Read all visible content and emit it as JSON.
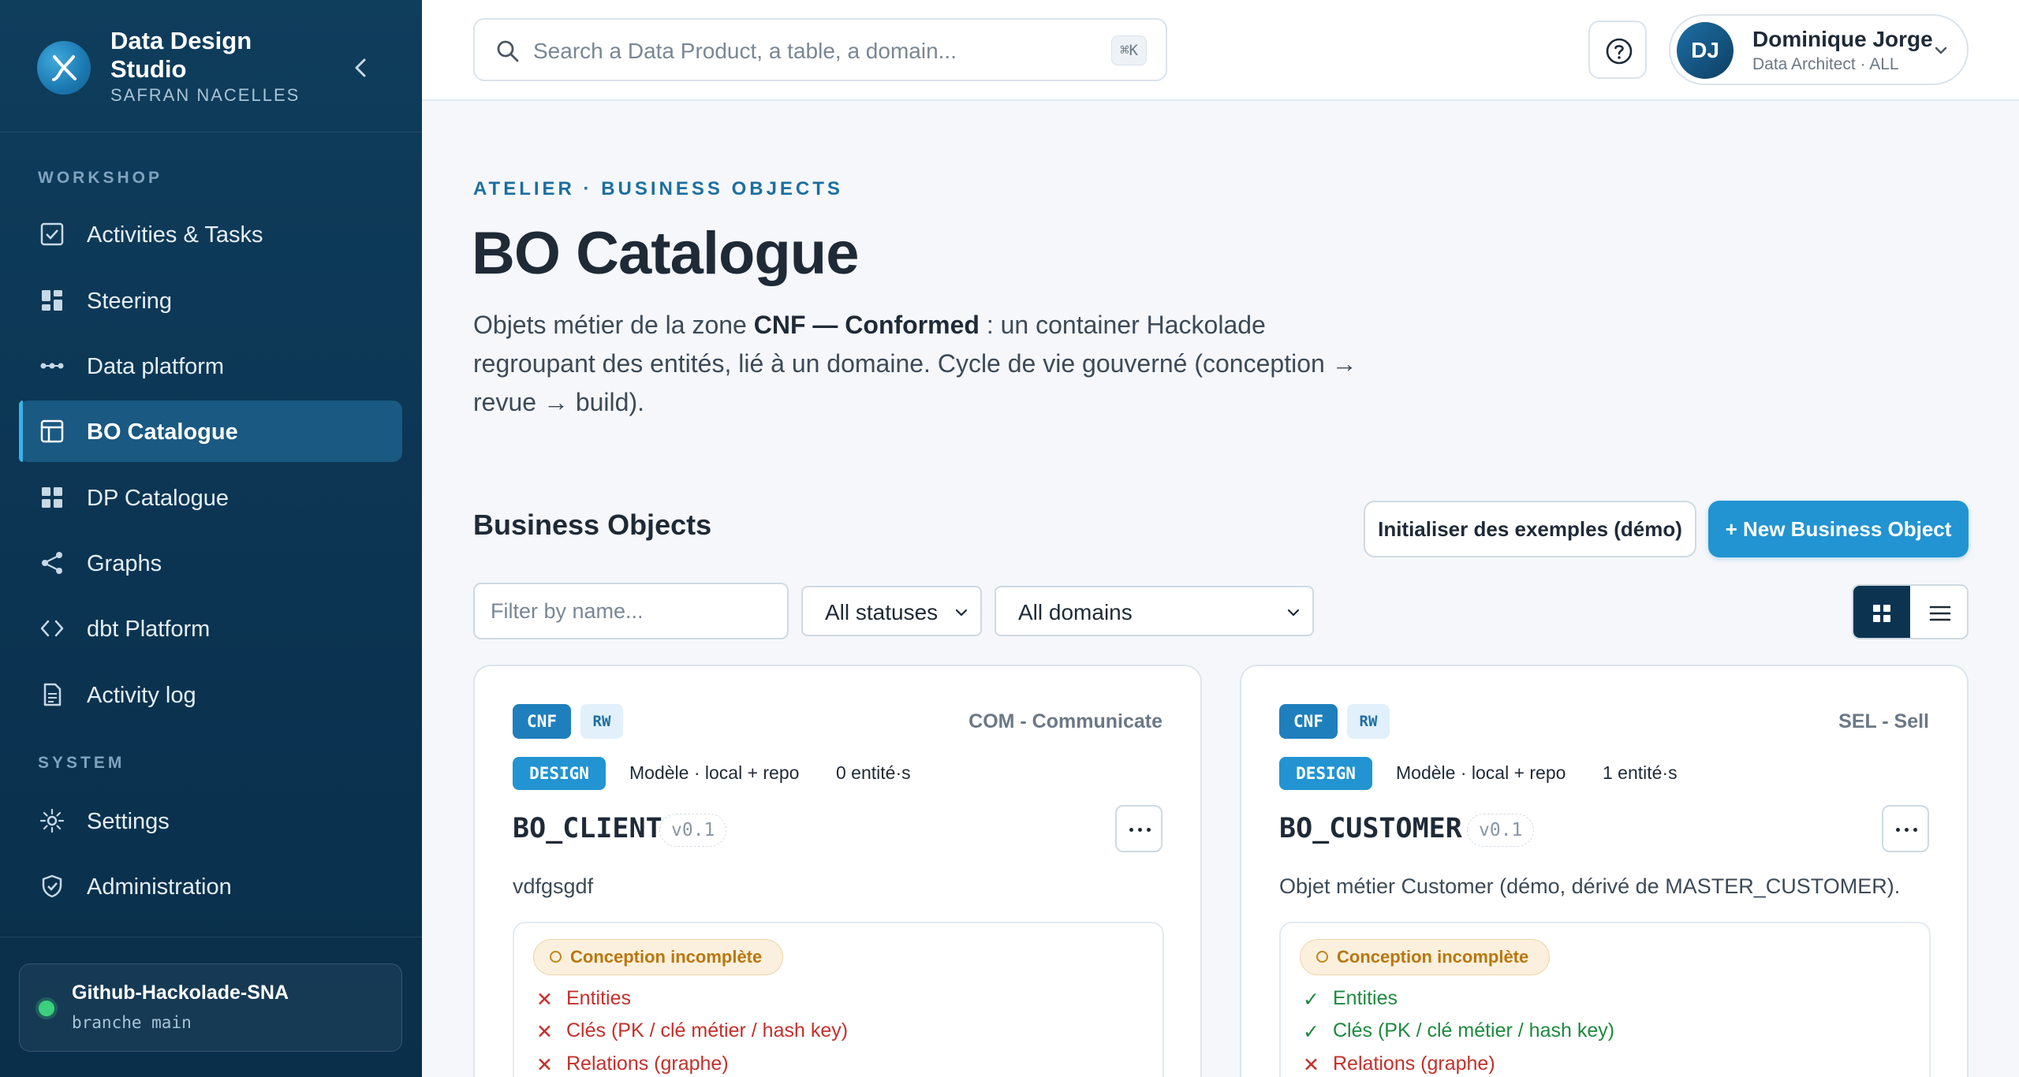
{
  "brand": {
    "title": "Data Design Studio",
    "subtitle": "SAFRAN NACELLES",
    "collapse_icon": "chevron-left-icon"
  },
  "sidebar": {
    "workshop_label": "WORKSHOP",
    "system_label": "SYSTEM",
    "items": [
      {
        "label": "Activities & Tasks",
        "icon": "checkbox-icon",
        "active": false
      },
      {
        "label": "Steering",
        "icon": "dashboard-icon",
        "active": false
      },
      {
        "label": "Data platform",
        "icon": "pipeline-icon",
        "active": false
      },
      {
        "label": "BO Catalogue",
        "icon": "layout-icon",
        "active": true
      },
      {
        "label": "DP Catalogue",
        "icon": "grid-icon",
        "active": false
      },
      {
        "label": "Graphs",
        "icon": "share-icon",
        "active": false
      },
      {
        "label": "dbt Platform",
        "icon": "code-icon",
        "active": false
      },
      {
        "label": "Activity log",
        "icon": "document-icon",
        "active": false
      }
    ],
    "system_items": [
      {
        "label": "Settings",
        "icon": "sun-gear-icon"
      },
      {
        "label": "Administration",
        "icon": "shield-check-icon"
      }
    ],
    "repo": {
      "name": "Github-Hackolade-SNA",
      "branch": "branche main",
      "status_color": "#3ad07e"
    }
  },
  "topbar": {
    "search_placeholder": "Search a Data Product, a table, a domain...",
    "search_shortcut": "⌘K",
    "help_icon": "help-circle-icon",
    "user": {
      "initials": "DJ",
      "name": "Dominique Jorge",
      "role": "Data Architect · ALL"
    }
  },
  "main": {
    "eyebrow": "ATELIER · BUSINESS OBJECTS",
    "title": "BO Catalogue",
    "intro_prefix": "Objets métier de la zone ",
    "intro_bold": "CNF — Conformed",
    "intro_suffix": " : un container Hackolade regroupant des entités, lié à un domaine. Cycle de vie gouverné (conception → revue → build).",
    "section_title": "Business Objects",
    "btn_demo": "Initialiser des exemples (démo)",
    "btn_new": "+ New Business Object",
    "filter_placeholder": "Filter by name...",
    "status_select": "All statuses",
    "domain_select": "All domains",
    "view_mode": "grid"
  },
  "cards": [
    {
      "zone": "CNF",
      "access": "RW",
      "domain": "COM - Communicate",
      "stage": "DESIGN",
      "model": "Modèle · local + repo",
      "entities": "0 entité·s",
      "name": "BO_CLIENT",
      "version": "v0.1",
      "description": "vdfgsgdf",
      "status": "Conception incomplète",
      "checks": [
        {
          "label": "Entities",
          "ok": false
        },
        {
          "label": "Clés (PK / clé métier / hash key)",
          "ok": false
        },
        {
          "label": "Relations (graphe)",
          "ok": false
        }
      ]
    },
    {
      "zone": "CNF",
      "access": "RW",
      "domain": "SEL - Sell",
      "stage": "DESIGN",
      "model": "Modèle · local + repo",
      "entities": "1 entité·s",
      "name": "BO_CUSTOMER",
      "version": "v0.1",
      "description": "Objet métier Customer (démo, dérivé de MASTER_CUSTOMER).",
      "status": "Conception incomplète",
      "checks": [
        {
          "label": "Entities",
          "ok": true
        },
        {
          "label": "Clés (PK / clé métier / hash key)",
          "ok": true
        },
        {
          "label": "Relations (graphe)",
          "ok": false
        }
      ]
    }
  ],
  "colors": {
    "sidebar_bg": "#0f3d5c",
    "accent": "#2294d1",
    "active_item": "#1a5982",
    "check_ok": "#1d8a3e",
    "check_fail": "#c4302b",
    "pill_warning": "#b9770e"
  }
}
